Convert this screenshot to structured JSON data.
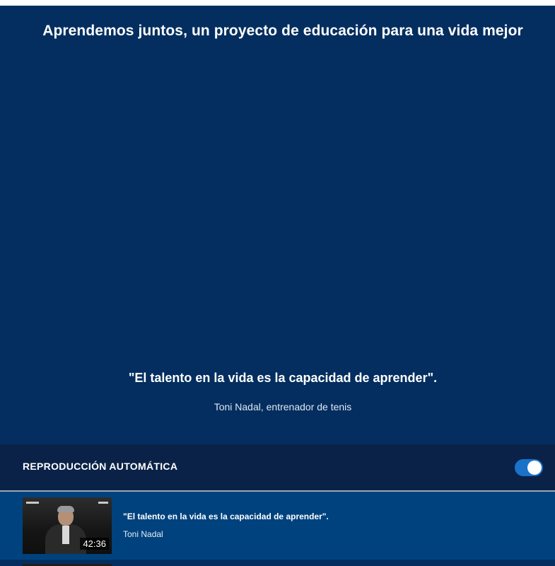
{
  "hero": {
    "title": "Aprendemos juntos, un proyecto de educación para una vida mejor",
    "quote": "\"El talento en la vida es la capacidad de aprender\".",
    "author": "Toni Nadal, entrenador de tenis"
  },
  "autoplay": {
    "label": "REPRODUCCIÓN AUTOMÁTICA",
    "enabled": true
  },
  "playlist": [
    {
      "title": "\"El talento en la vida es la capacidad de aprender\".",
      "author": "Toni Nadal",
      "duration": "42:36"
    }
  ],
  "colors": {
    "hero_bg": "#032e5f",
    "autoplay_bg": "#0a2247",
    "item_bg": "#00427e",
    "toggle_on": "#1a73c9"
  }
}
